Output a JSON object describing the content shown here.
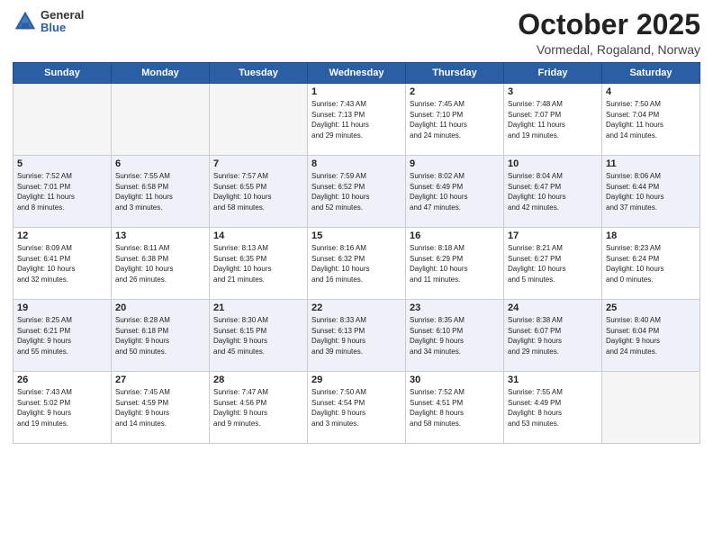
{
  "header": {
    "logo_general": "General",
    "logo_blue": "Blue",
    "month": "October 2025",
    "location": "Vormedal, Rogaland, Norway"
  },
  "weekdays": [
    "Sunday",
    "Monday",
    "Tuesday",
    "Wednesday",
    "Thursday",
    "Friday",
    "Saturday"
  ],
  "weeks": [
    [
      {
        "day": "",
        "info": ""
      },
      {
        "day": "",
        "info": ""
      },
      {
        "day": "",
        "info": ""
      },
      {
        "day": "1",
        "info": "Sunrise: 7:43 AM\nSunset: 7:13 PM\nDaylight: 11 hours\nand 29 minutes."
      },
      {
        "day": "2",
        "info": "Sunrise: 7:45 AM\nSunset: 7:10 PM\nDaylight: 11 hours\nand 24 minutes."
      },
      {
        "day": "3",
        "info": "Sunrise: 7:48 AM\nSunset: 7:07 PM\nDaylight: 11 hours\nand 19 minutes."
      },
      {
        "day": "4",
        "info": "Sunrise: 7:50 AM\nSunset: 7:04 PM\nDaylight: 11 hours\nand 14 minutes."
      }
    ],
    [
      {
        "day": "5",
        "info": "Sunrise: 7:52 AM\nSunset: 7:01 PM\nDaylight: 11 hours\nand 8 minutes."
      },
      {
        "day": "6",
        "info": "Sunrise: 7:55 AM\nSunset: 6:58 PM\nDaylight: 11 hours\nand 3 minutes."
      },
      {
        "day": "7",
        "info": "Sunrise: 7:57 AM\nSunset: 6:55 PM\nDaylight: 10 hours\nand 58 minutes."
      },
      {
        "day": "8",
        "info": "Sunrise: 7:59 AM\nSunset: 6:52 PM\nDaylight: 10 hours\nand 52 minutes."
      },
      {
        "day": "9",
        "info": "Sunrise: 8:02 AM\nSunset: 6:49 PM\nDaylight: 10 hours\nand 47 minutes."
      },
      {
        "day": "10",
        "info": "Sunrise: 8:04 AM\nSunset: 6:47 PM\nDaylight: 10 hours\nand 42 minutes."
      },
      {
        "day": "11",
        "info": "Sunrise: 8:06 AM\nSunset: 6:44 PM\nDaylight: 10 hours\nand 37 minutes."
      }
    ],
    [
      {
        "day": "12",
        "info": "Sunrise: 8:09 AM\nSunset: 6:41 PM\nDaylight: 10 hours\nand 32 minutes."
      },
      {
        "day": "13",
        "info": "Sunrise: 8:11 AM\nSunset: 6:38 PM\nDaylight: 10 hours\nand 26 minutes."
      },
      {
        "day": "14",
        "info": "Sunrise: 8:13 AM\nSunset: 6:35 PM\nDaylight: 10 hours\nand 21 minutes."
      },
      {
        "day": "15",
        "info": "Sunrise: 8:16 AM\nSunset: 6:32 PM\nDaylight: 10 hours\nand 16 minutes."
      },
      {
        "day": "16",
        "info": "Sunrise: 8:18 AM\nSunset: 6:29 PM\nDaylight: 10 hours\nand 11 minutes."
      },
      {
        "day": "17",
        "info": "Sunrise: 8:21 AM\nSunset: 6:27 PM\nDaylight: 10 hours\nand 5 minutes."
      },
      {
        "day": "18",
        "info": "Sunrise: 8:23 AM\nSunset: 6:24 PM\nDaylight: 10 hours\nand 0 minutes."
      }
    ],
    [
      {
        "day": "19",
        "info": "Sunrise: 8:25 AM\nSunset: 6:21 PM\nDaylight: 9 hours\nand 55 minutes."
      },
      {
        "day": "20",
        "info": "Sunrise: 8:28 AM\nSunset: 6:18 PM\nDaylight: 9 hours\nand 50 minutes."
      },
      {
        "day": "21",
        "info": "Sunrise: 8:30 AM\nSunset: 6:15 PM\nDaylight: 9 hours\nand 45 minutes."
      },
      {
        "day": "22",
        "info": "Sunrise: 8:33 AM\nSunset: 6:13 PM\nDaylight: 9 hours\nand 39 minutes."
      },
      {
        "day": "23",
        "info": "Sunrise: 8:35 AM\nSunset: 6:10 PM\nDaylight: 9 hours\nand 34 minutes."
      },
      {
        "day": "24",
        "info": "Sunrise: 8:38 AM\nSunset: 6:07 PM\nDaylight: 9 hours\nand 29 minutes."
      },
      {
        "day": "25",
        "info": "Sunrise: 8:40 AM\nSunset: 6:04 PM\nDaylight: 9 hours\nand 24 minutes."
      }
    ],
    [
      {
        "day": "26",
        "info": "Sunrise: 7:43 AM\nSunset: 5:02 PM\nDaylight: 9 hours\nand 19 minutes."
      },
      {
        "day": "27",
        "info": "Sunrise: 7:45 AM\nSunset: 4:59 PM\nDaylight: 9 hours\nand 14 minutes."
      },
      {
        "day": "28",
        "info": "Sunrise: 7:47 AM\nSunset: 4:56 PM\nDaylight: 9 hours\nand 9 minutes."
      },
      {
        "day": "29",
        "info": "Sunrise: 7:50 AM\nSunset: 4:54 PM\nDaylight: 9 hours\nand 3 minutes."
      },
      {
        "day": "30",
        "info": "Sunrise: 7:52 AM\nSunset: 4:51 PM\nDaylight: 8 hours\nand 58 minutes."
      },
      {
        "day": "31",
        "info": "Sunrise: 7:55 AM\nSunset: 4:49 PM\nDaylight: 8 hours\nand 53 minutes."
      },
      {
        "day": "",
        "info": ""
      }
    ]
  ]
}
